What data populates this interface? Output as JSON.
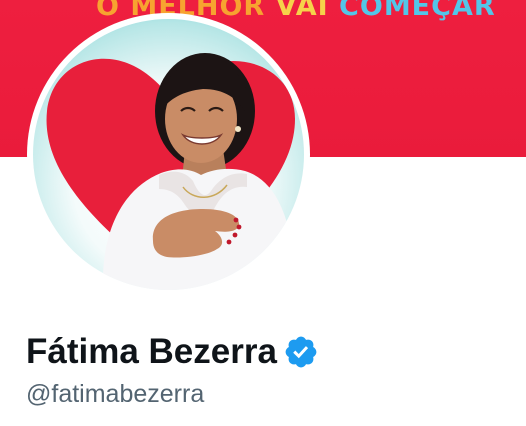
{
  "banner": {
    "slogan_word_1": "O MELHOR",
    "slogan_word_2": "VAI",
    "slogan_word_3": "COMEÇAR",
    "background_color": "#ee1f3f"
  },
  "profile": {
    "display_name": "Fátima Bezerra",
    "handle": "@fatimabezerra",
    "verified": true,
    "verified_color": "#1d9bf0"
  },
  "icons": {
    "verified": "verified-badge-icon"
  }
}
